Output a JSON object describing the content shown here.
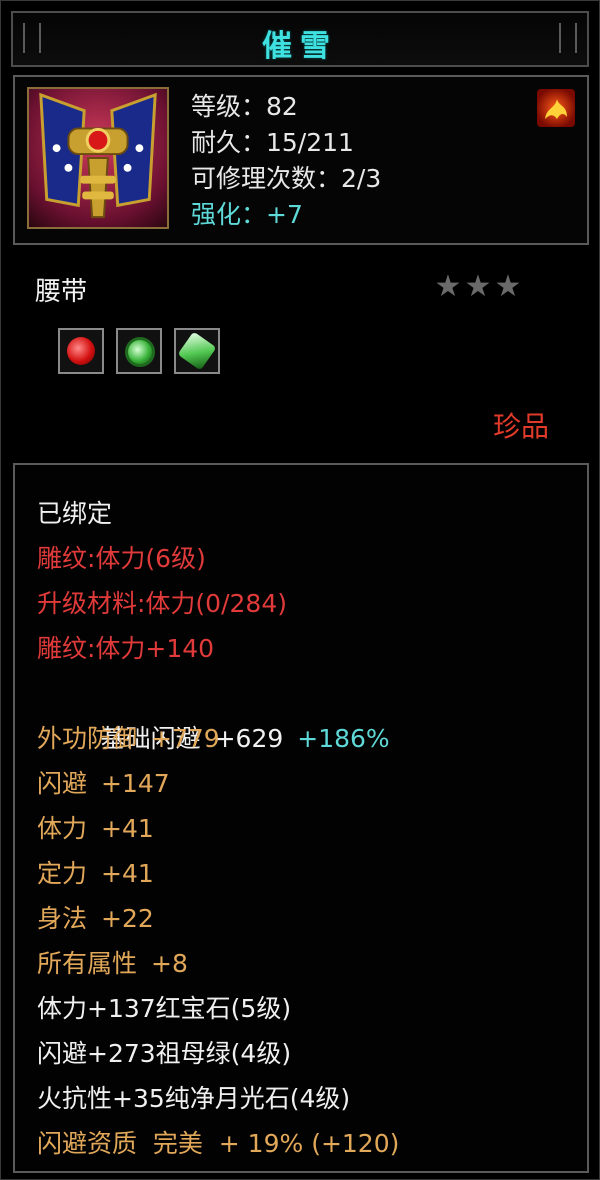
{
  "title": "催雪",
  "header": {
    "level_label": "等级：82",
    "durability_label": "耐久：15/211",
    "repair_label": "可修理次数：2/3",
    "enhance_label": "强化：+7"
  },
  "item": {
    "type": "腰带",
    "stars": 3,
    "rarity": "珍品",
    "gems": [
      "ruby-gem-icon",
      "emerald-gem-icon",
      "moonstone-gem-icon"
    ]
  },
  "attributes": {
    "bound": "已绑定",
    "engrave": "雕纹:体力(6级)",
    "upgrade_material": "升级材料:体力(0/284)",
    "engrave_bonus": "雕纹:体力+140",
    "base_dodge": {
      "name": "基础闪避",
      "value": "+629",
      "extra": "+186%"
    },
    "lines": [
      {
        "name": "外功防御",
        "value": "+779"
      },
      {
        "name": "闪避",
        "value": "+147"
      },
      {
        "name": "体力",
        "value": "+41"
      },
      {
        "name": "定力",
        "value": "+41"
      },
      {
        "name": "身法",
        "value": "+22"
      },
      {
        "name": "所有属性",
        "value": "+8"
      }
    ],
    "gem_lines": [
      "体力+137红宝石(5级)",
      "闪避+273祖母绿(4级)",
      "火抗性+35纯净月光石(4级)"
    ],
    "quality": "闪避资质  完美  + 19% (+120)"
  },
  "colors": {
    "title": "#3ee0e0",
    "red": "#e03a3a",
    "orange": "#e2a85a",
    "cyan": "#5fd8d8"
  }
}
